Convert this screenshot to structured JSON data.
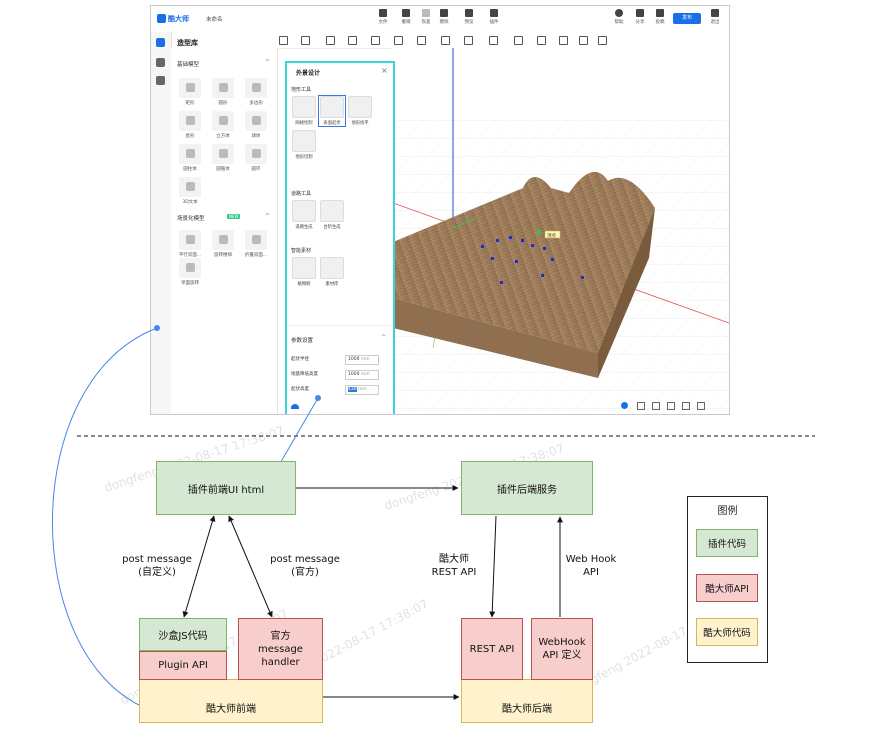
{
  "app": {
    "logo": "酷大师",
    "doc_name": "未命名",
    "toolbar": [
      {
        "label": "文件"
      },
      {
        "label": "撤销"
      },
      {
        "label": "恢复"
      },
      {
        "label": "擦除"
      },
      {
        "label": "预览"
      },
      {
        "label": "插件"
      },
      {
        "label": "帮助"
      },
      {
        "label": "分享"
      },
      {
        "label": "投稿"
      },
      {
        "label": "发布"
      },
      {
        "label": "退出"
      }
    ],
    "library": {
      "title": "造型库",
      "section_basic": "基础模型",
      "basic_shapes": [
        "矩形",
        "圆形",
        "多边形",
        "星形",
        "立方体",
        "球体",
        "圆柱体",
        "圆锥体",
        "圆环",
        "3D文本"
      ],
      "section_scene": "场景化模型",
      "scene_badge": "NEW",
      "scene_shapes": [
        "平行双面...",
        "旋转楼梯",
        "折叠双面...",
        "单面旋转"
      ]
    },
    "panel": {
      "title": "外景设计",
      "group_terrain": "地形工具",
      "terrain_tools": [
        "网格绘制",
        "表面起伏",
        "地形找平",
        "地形切割"
      ],
      "group_road": "道路工具",
      "road_tools": [
        "道路生成",
        "台阶生成"
      ],
      "group_material": "智能素材",
      "material_tools": [
        "植物刷",
        "素材库"
      ],
      "params_title": "参数设置",
      "params": [
        {
          "label": "起伏半径",
          "value": "1000",
          "unit": "mm"
        },
        {
          "label": "地基降低高度",
          "value": "1000",
          "unit": "mm"
        },
        {
          "label": "起伏高度",
          "value": "430",
          "unit": "mm"
        }
      ]
    },
    "viewport": {
      "tooltip": "顶点"
    }
  },
  "diagram": {
    "nodes": {
      "plugin_ui": "插件前端UI html",
      "plugin_backend": "插件后端服务",
      "sandbox_js": "沙盒JS代码",
      "plugin_api": "Plugin API",
      "official_handler_1": "官方",
      "official_handler_2": "message handler",
      "kds_frontend": "酷大师前端",
      "rest_api": "REST API",
      "webhook_def_1": "WebHook",
      "webhook_def_2": "API 定义",
      "kds_backend": "酷大师后端"
    },
    "edge_labels": {
      "pm_custom_1": "post message",
      "pm_custom_2": "(自定义)",
      "pm_official_1": "post message",
      "pm_official_2": "(官方)",
      "rest_1": "酷大师",
      "rest_2": "REST API",
      "webhook_1": "Web Hook",
      "webhook_2": "API"
    },
    "legend": {
      "title": "图例",
      "items": [
        "插件代码",
        "酷大师API",
        "酷大师代码"
      ]
    },
    "colors": {
      "green_fill": "#d5e8d4",
      "green_stroke": "#82b366",
      "red_fill": "#f8cecc",
      "red_stroke": "#b85450",
      "yellow_fill": "#fff2cc",
      "yellow_stroke": "#d6b656",
      "callout": "#4a86e8",
      "panel_highlight": "#39d5dc"
    },
    "watermark": "dongfeng 2022-08-17 17:38:07"
  }
}
